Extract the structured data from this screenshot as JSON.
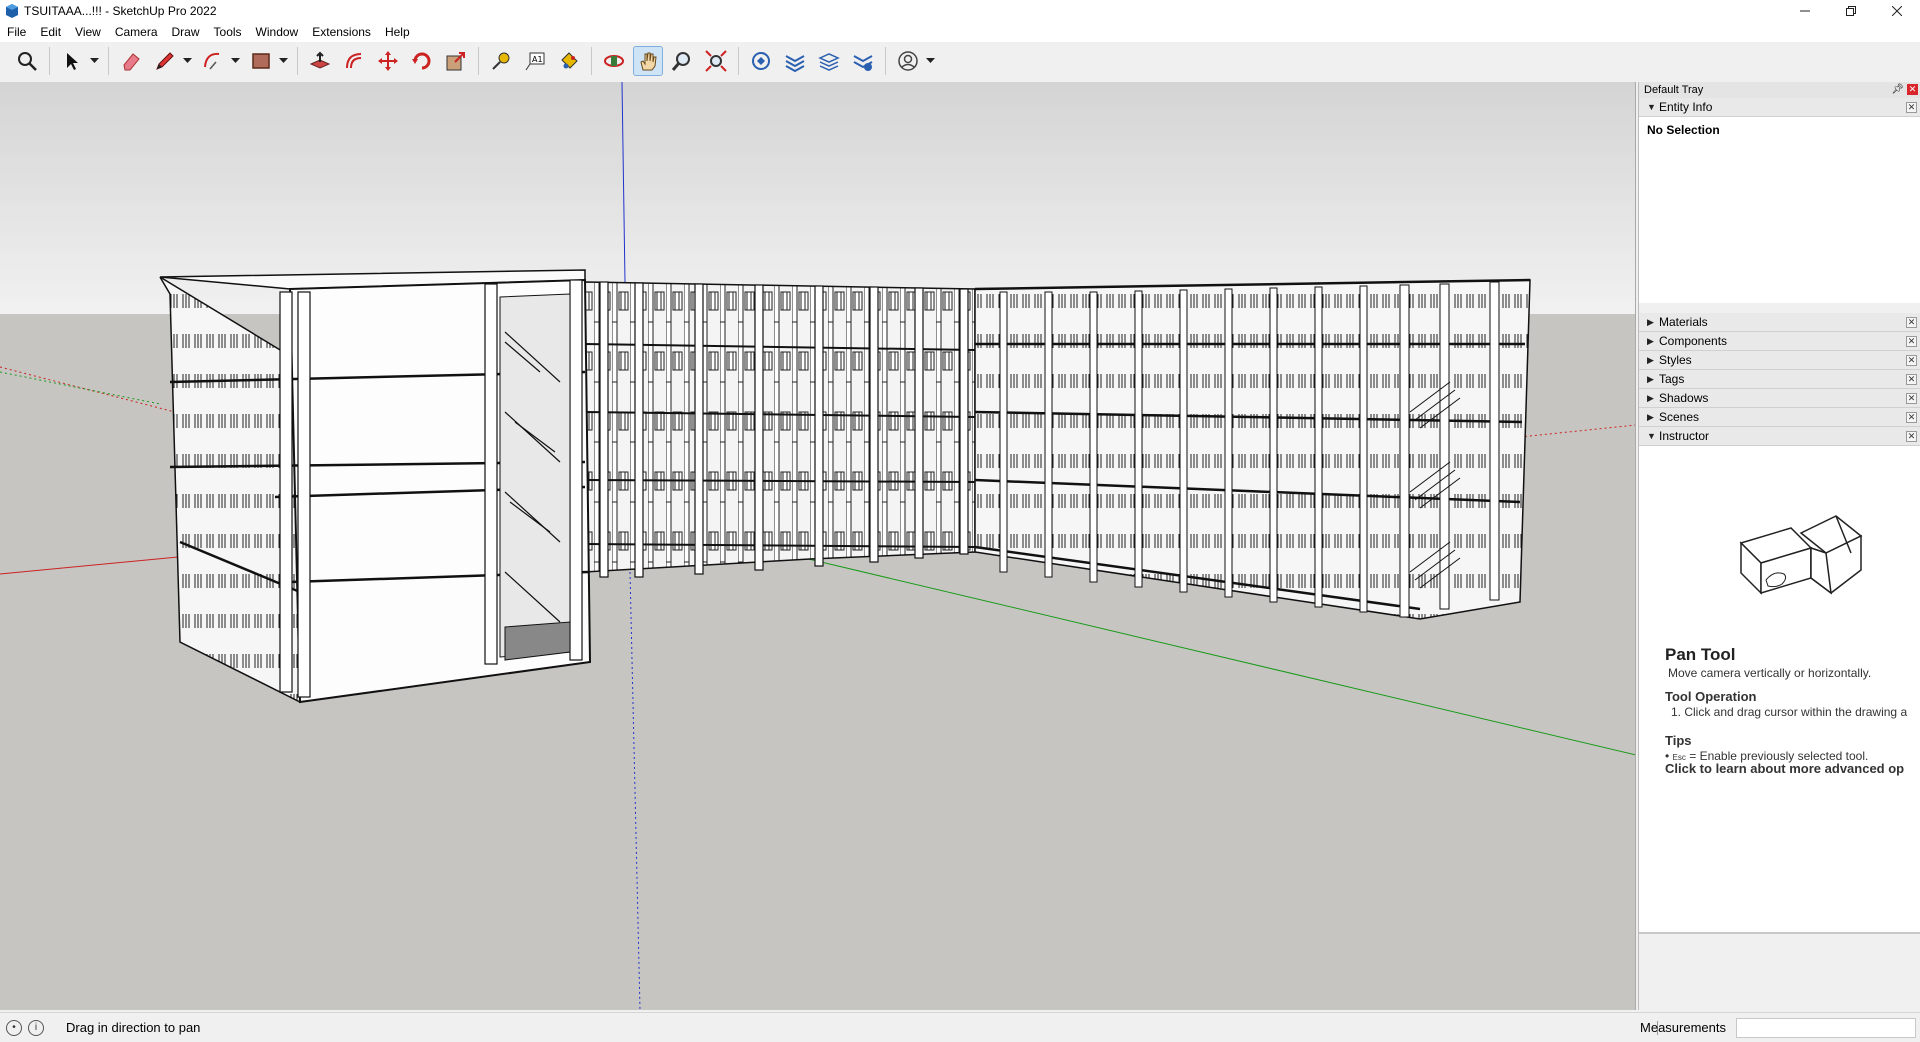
{
  "window": {
    "title": "TSUITAAA...!!! - SketchUp Pro 2022",
    "controls": [
      "minimize",
      "restore",
      "close"
    ]
  },
  "menu": [
    "File",
    "Edit",
    "View",
    "Camera",
    "Draw",
    "Tools",
    "Window",
    "Extensions",
    "Help"
  ],
  "toolbar": {
    "tools": [
      {
        "icon": "search-icon"
      },
      {
        "icon": "select-arrow-icon"
      },
      {
        "icon": "eraser-icon"
      },
      {
        "icon": "pencil-icon"
      },
      {
        "icon": "arc-icon"
      },
      {
        "icon": "rectangle-icon"
      },
      {
        "icon": "push-pull-icon"
      },
      {
        "icon": "offset-icon"
      },
      {
        "icon": "move-icon"
      },
      {
        "icon": "rotate-icon"
      },
      {
        "icon": "scale-icon"
      },
      {
        "icon": "tape-measure-icon"
      },
      {
        "icon": "text-icon"
      },
      {
        "icon": "paint-bucket-icon"
      },
      {
        "icon": "orbit-icon"
      },
      {
        "icon": "pan-icon",
        "active": true
      },
      {
        "icon": "zoom-icon"
      },
      {
        "icon": "zoom-extents-icon"
      },
      {
        "icon": "warehouse-icon"
      },
      {
        "icon": "extension-warehouse-icon"
      },
      {
        "icon": "layout-icon"
      },
      {
        "icon": "extension-manager-icon"
      },
      {
        "icon": "account-icon"
      }
    ]
  },
  "tray": {
    "title": "Default Tray",
    "entity_info": {
      "label": "Entity Info",
      "value": "No Selection"
    },
    "panels": [
      "Materials",
      "Components",
      "Styles",
      "Tags",
      "Shadows",
      "Scenes"
    ],
    "instructor": {
      "label": "Instructor",
      "tool_name": "Pan Tool",
      "tool_desc": "Move camera vertically or horizontally.",
      "operation_heading": "Tool Operation",
      "operation_step": "1. Click and drag cursor within the drawing a",
      "tips_heading": "Tips",
      "tip_key": "Esc",
      "tip_text": "= Enable previously selected tool.",
      "learn_more": "Click to learn about more advanced op"
    }
  },
  "status": {
    "hint": "Drag in direction to pan",
    "measurements_label": "Measurements",
    "measurements_value": ""
  },
  "colors": {
    "sky": "#e9e9e9",
    "ground": "#c6c5c1",
    "axis_red": "#c22",
    "axis_green": "#1a9a1a",
    "axis_blue": "#2233cc",
    "active_tool": "#cfe3f7",
    "close_red": "#d9262c"
  }
}
